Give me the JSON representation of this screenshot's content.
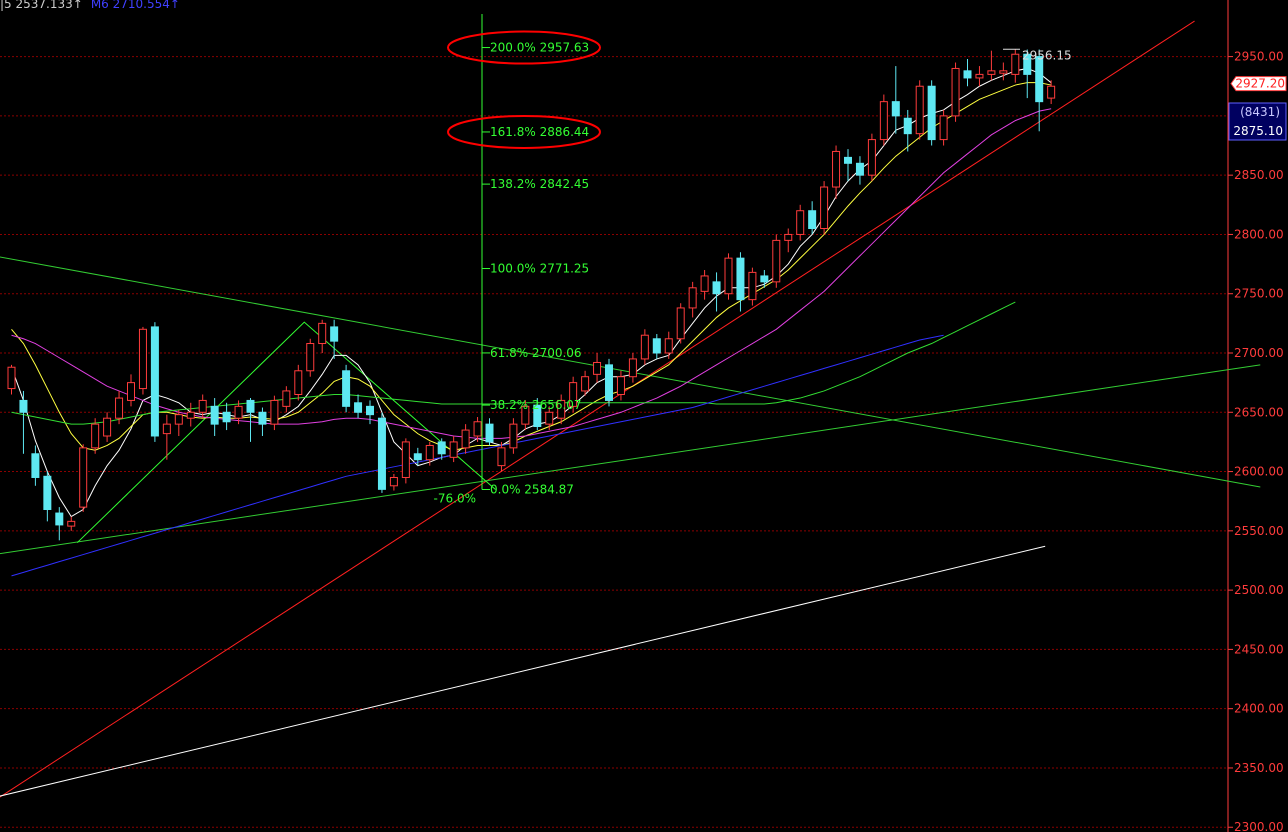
{
  "header": {
    "ma5_label": "|5 2537.133↑",
    "ma6_label": "M6 2710.554↑"
  },
  "colors": {
    "background": "#000000",
    "grid": "#8b0000",
    "axis_text": "#ff3c3c",
    "up_candle": "#ff3c3c",
    "down_candle": "#5ee8f2",
    "fib": "#33ff33",
    "highlight_ellipse": "#ff0000",
    "ma_white": "#ffffff",
    "ma_yellow": "#ffff40",
    "ma_magenta": "#e040e0",
    "ma_green": "#33dd33",
    "ma_blue": "#3030ff"
  },
  "chart_data": {
    "type": "candlestick",
    "y_axis": {
      "range": [
        2300,
        2960
      ],
      "side": "right",
      "ticks": [
        "2300.00",
        "2350.00",
        "2400.00",
        "2450.00",
        "2500.00",
        "2550.00",
        "2600.00",
        "2650.00",
        "2700.00",
        "2750.00",
        "2800.00",
        "2850.00",
        "2900.00",
        "2950.00"
      ]
    },
    "price_labels": {
      "last": "2927.20",
      "volume": "(8431)",
      "cursor_price": "2875.10",
      "high_label": "2956.15"
    },
    "grid": true,
    "fibonacci": [
      {
        "pct": "200.0%",
        "value": 2957.63,
        "text": "200.0% 2957.63",
        "highlighted": true
      },
      {
        "pct": "161.8%",
        "value": 2886.44,
        "text": "161.8% 2886.44",
        "highlighted": true
      },
      {
        "pct": "138.2%",
        "value": 2842.45,
        "text": "138.2% 2842.45"
      },
      {
        "pct": "100.0%",
        "value": 2771.25,
        "text": "100.0% 2771.25"
      },
      {
        "pct": "61.8%",
        "value": 2700.06,
        "text": "61.8% 2700.06"
      },
      {
        "pct": "38.2%",
        "value": 2656.07,
        "text": "38.2% 2656.07"
      },
      {
        "pct": "0.0%",
        "value": 2584.87,
        "text": "0.0% 2584.87"
      }
    ],
    "fib_side_label": "-76.0%",
    "candles": [
      [
        2670,
        2688,
        2665,
        2690
      ],
      [
        2660,
        2650,
        2615,
        2668
      ],
      [
        2615,
        2595,
        2588,
        2622
      ],
      [
        2596,
        2568,
        2558,
        2600
      ],
      [
        2565,
        2555,
        2542,
        2570
      ],
      [
        2554,
        2558,
        2550,
        2562
      ],
      [
        2570,
        2620,
        2566,
        2623
      ],
      [
        2620,
        2640,
        2615,
        2645
      ],
      [
        2630,
        2645,
        2625,
        2650
      ],
      [
        2645,
        2662,
        2640,
        2668
      ],
      [
        2660,
        2675,
        2655,
        2682
      ],
      [
        2670,
        2720,
        2665,
        2722
      ],
      [
        2722,
        2630,
        2625,
        2726
      ],
      [
        2632,
        2640,
        2610,
        2648
      ],
      [
        2640,
        2648,
        2630,
        2652
      ],
      [
        2645,
        2650,
        2638,
        2658
      ],
      [
        2650,
        2660,
        2645,
        2665
      ],
      [
        2655,
        2640,
        2630,
        2662
      ],
      [
        2650,
        2642,
        2635,
        2658
      ],
      [
        2645,
        2655,
        2640,
        2660
      ],
      [
        2660,
        2650,
        2625,
        2662
      ],
      [
        2650,
        2640,
        2630,
        2654
      ],
      [
        2640,
        2660,
        2635,
        2664
      ],
      [
        2655,
        2668,
        2650,
        2672
      ],
      [
        2665,
        2685,
        2660,
        2690
      ],
      [
        2685,
        2708,
        2680,
        2712
      ],
      [
        2708,
        2725,
        2700,
        2728
      ],
      [
        2722,
        2710,
        2695,
        2728
      ],
      [
        2685,
        2655,
        2650,
        2690
      ],
      [
        2658,
        2650,
        2645,
        2665
      ],
      [
        2655,
        2648,
        2640,
        2660
      ],
      [
        2645,
        2585,
        2582,
        2650
      ],
      [
        2588,
        2595,
        2584,
        2598
      ],
      [
        2595,
        2625,
        2590,
        2628
      ],
      [
        2615,
        2610,
        2605,
        2620
      ],
      [
        2610,
        2622,
        2605,
        2625
      ],
      [
        2625,
        2615,
        2610,
        2628
      ],
      [
        2612,
        2625,
        2608,
        2630
      ],
      [
        2620,
        2635,
        2615,
        2640
      ],
      [
        2630,
        2642,
        2625,
        2646
      ],
      [
        2640,
        2625,
        2622,
        2645
      ],
      [
        2605,
        2620,
        2600,
        2625
      ],
      [
        2620,
        2640,
        2615,
        2645
      ],
      [
        2640,
        2655,
        2635,
        2660
      ],
      [
        2656,
        2638,
        2635,
        2662
      ],
      [
        2640,
        2650,
        2635,
        2655
      ],
      [
        2645,
        2660,
        2640,
        2665
      ],
      [
        2655,
        2675,
        2650,
        2680
      ],
      [
        2668,
        2680,
        2664,
        2685
      ],
      [
        2682,
        2692,
        2675,
        2700
      ],
      [
        2690,
        2660,
        2655,
        2695
      ],
      [
        2665,
        2680,
        2660,
        2685
      ],
      [
        2680,
        2695,
        2675,
        2700
      ],
      [
        2695,
        2715,
        2690,
        2720
      ],
      [
        2712,
        2700,
        2695,
        2716
      ],
      [
        2700,
        2712,
        2695,
        2718
      ],
      [
        2712,
        2738,
        2708,
        2742
      ],
      [
        2738,
        2755,
        2730,
        2760
      ],
      [
        2752,
        2765,
        2745,
        2770
      ],
      [
        2760,
        2750,
        2735,
        2768
      ],
      [
        2750,
        2780,
        2745,
        2784
      ],
      [
        2780,
        2745,
        2735,
        2785
      ],
      [
        2745,
        2768,
        2740,
        2772
      ],
      [
        2765,
        2760,
        2755,
        2770
      ],
      [
        2760,
        2795,
        2755,
        2800
      ],
      [
        2795,
        2800,
        2785,
        2805
      ],
      [
        2800,
        2820,
        2795,
        2825
      ],
      [
        2820,
        2805,
        2800,
        2828
      ],
      [
        2805,
        2840,
        2800,
        2845
      ],
      [
        2840,
        2870,
        2830,
        2875
      ],
      [
        2865,
        2860,
        2845,
        2872
      ],
      [
        2860,
        2850,
        2842,
        2866
      ],
      [
        2850,
        2880,
        2845,
        2885
      ],
      [
        2880,
        2912,
        2875,
        2918
      ],
      [
        2912,
        2900,
        2885,
        2942
      ],
      [
        2898,
        2885,
        2870,
        2905
      ],
      [
        2885,
        2925,
        2880,
        2930
      ],
      [
        2925,
        2880,
        2875,
        2930
      ],
      [
        2880,
        2900,
        2875,
        2905
      ],
      [
        2900,
        2940,
        2895,
        2945
      ],
      [
        2938,
        2932,
        2925,
        2948
      ],
      [
        2932,
        2935,
        2925,
        2942
      ],
      [
        2935,
        2938,
        2930,
        2955
      ],
      [
        2936,
        2938,
        2930,
        2945
      ],
      [
        2935,
        2952,
        2928,
        2956
      ],
      [
        2952,
        2935,
        2915,
        2956
      ],
      [
        2950,
        2912,
        2887,
        2956
      ],
      [
        2915,
        2925,
        2910,
        2930
      ]
    ],
    "ma_series": [
      {
        "color": "#ffffff",
        "values": [
          2688,
          2660,
          2626,
          2600,
          2578,
          2562,
          2568,
          2588,
          2605,
          2618,
          2636,
          2660,
          2665,
          2662,
          2658,
          2650,
          2648,
          2650,
          2648,
          2646,
          2648,
          2644,
          2642,
          2648,
          2655,
          2668,
          2682,
          2698,
          2698,
          2690,
          2675,
          2650,
          2625,
          2615,
          2605,
          2608,
          2612,
          2614,
          2622,
          2628,
          2625,
          2622,
          2628,
          2636,
          2640,
          2642,
          2648,
          2656,
          2665,
          2675,
          2680,
          2680,
          2682,
          2690,
          2695,
          2698,
          2712,
          2725,
          2738,
          2748,
          2755,
          2755,
          2755,
          2758,
          2765,
          2775,
          2790,
          2800,
          2815,
          2832,
          2845,
          2855,
          2862,
          2875,
          2888,
          2892,
          2898,
          2902,
          2905,
          2912,
          2918,
          2925,
          2930,
          2934,
          2938,
          2940,
          2936,
          2928
        ]
      },
      {
        "color": "#ffff40",
        "values": [
          2720,
          2708,
          2690,
          2670,
          2650,
          2632,
          2620,
          2618,
          2622,
          2628,
          2638,
          2648,
          2650,
          2650,
          2648,
          2646,
          2645,
          2646,
          2645,
          2645,
          2646,
          2645,
          2644,
          2646,
          2650,
          2658,
          2666,
          2676,
          2680,
          2678,
          2672,
          2660,
          2648,
          2640,
          2632,
          2626,
          2622,
          2618,
          2620,
          2622,
          2622,
          2622,
          2625,
          2630,
          2634,
          2638,
          2642,
          2648,
          2654,
          2660,
          2665,
          2668,
          2672,
          2678,
          2684,
          2690,
          2700,
          2710,
          2720,
          2730,
          2738,
          2744,
          2750,
          2756,
          2762,
          2770,
          2780,
          2790,
          2800,
          2812,
          2824,
          2835,
          2845,
          2856,
          2866,
          2874,
          2882,
          2890,
          2896,
          2902,
          2908,
          2914,
          2918,
          2922,
          2926,
          2928,
          2928,
          2926
        ]
      },
      {
        "color": "#e040e0",
        "values": [
          2715,
          2712,
          2708,
          2702,
          2696,
          2690,
          2684,
          2678,
          2672,
          2668,
          2664,
          2660,
          2656,
          2653,
          2650,
          2648,
          2646,
          2645,
          2644,
          2643,
          2642,
          2641,
          2640,
          2640,
          2640,
          2641,
          2642,
          2644,
          2645,
          2645,
          2644,
          2642,
          2640,
          2638,
          2636,
          2634,
          2632,
          2630,
          2629,
          2628,
          2628,
          2628,
          2629,
          2630,
          2632,
          2634,
          2636,
          2638,
          2641,
          2644,
          2647,
          2650,
          2654,
          2658,
          2662,
          2667,
          2672,
          2678,
          2684,
          2690,
          2696,
          2702,
          2708,
          2714,
          2720,
          2728,
          2736,
          2744,
          2752,
          2762,
          2772,
          2782,
          2792,
          2802,
          2812,
          2822,
          2832,
          2842,
          2852,
          2860,
          2868,
          2876,
          2884,
          2890,
          2896,
          2900,
          2904,
          2906
        ]
      },
      {
        "color": "#33dd33",
        "values": [
          2650,
          2648,
          2646,
          2644,
          2642,
          2640,
          2640,
          2641,
          2642,
          2644,
          2646,
          2648,
          2650,
          2651,
          2652,
          2653,
          2654,
          2655,
          2656,
          2657,
          2658,
          2659,
          2660,
          2661,
          2662,
          2663,
          2664,
          2665,
          2665,
          2664,
          2663,
          2662,
          2661,
          2660,
          2659,
          2658,
          2657,
          2657,
          2657,
          2657,
          2657,
          2657,
          2658,
          2658,
          2658,
          2658,
          2658,
          2658,
          2658,
          2658,
          2658,
          2658,
          2658,
          2658,
          2658,
          2658,
          2658,
          2658,
          2658,
          2657,
          2657,
          2657,
          2657,
          2657,
          2658,
          2660,
          2662,
          2665,
          2668,
          2672,
          2676,
          2680,
          2685,
          2690,
          2695,
          2700,
          2704,
          2708,
          2713,
          2718,
          2723,
          2728,
          2733,
          2738,
          2743
        ]
      },
      {
        "color": "#3030ff",
        "values": [
          2512,
          2515,
          2518,
          2521,
          2524,
          2527,
          2530,
          2533,
          2536,
          2539,
          2542,
          2545,
          2548,
          2551,
          2554,
          2557,
          2560,
          2563,
          2566,
          2569,
          2572,
          2575,
          2578,
          2581,
          2584,
          2587,
          2590,
          2593,
          2596,
          2598,
          2600,
          2602,
          2604,
          2606,
          2608,
          2610,
          2612,
          2614,
          2616,
          2618,
          2620,
          2622,
          2624,
          2626,
          2628,
          2630,
          2632,
          2634,
          2636,
          2638,
          2640,
          2642,
          2644,
          2646,
          2648,
          2650,
          2652,
          2654,
          2657,
          2660,
          2663,
          2666,
          2669,
          2672,
          2675,
          2678,
          2681,
          2684,
          2687,
          2690,
          2693,
          2696,
          2699,
          2702,
          2705,
          2708,
          2711,
          2713,
          2715
        ]
      }
    ],
    "trend_lines": [
      {
        "color": "#ff2020",
        "from": [
          -1.5,
          2322
        ],
        "to": [
          99.0,
          2980
        ]
      },
      {
        "color": "#33cc33",
        "from": [
          -1.5,
          2530
        ],
        "to": [
          104.5,
          2690
        ]
      },
      {
        "color": "#33cc33",
        "from": [
          -1.5,
          2782
        ],
        "to": [
          104.5,
          2587
        ]
      },
      {
        "color": "#ffffff",
        "from": [
          -1.5,
          2325
        ],
        "to": [
          86.5,
          2537
        ]
      }
    ],
    "zigzag": [
      [
        5.5,
        2540
      ],
      [
        24.5,
        2726
      ],
      [
        40.5,
        2584.87
      ]
    ]
  }
}
